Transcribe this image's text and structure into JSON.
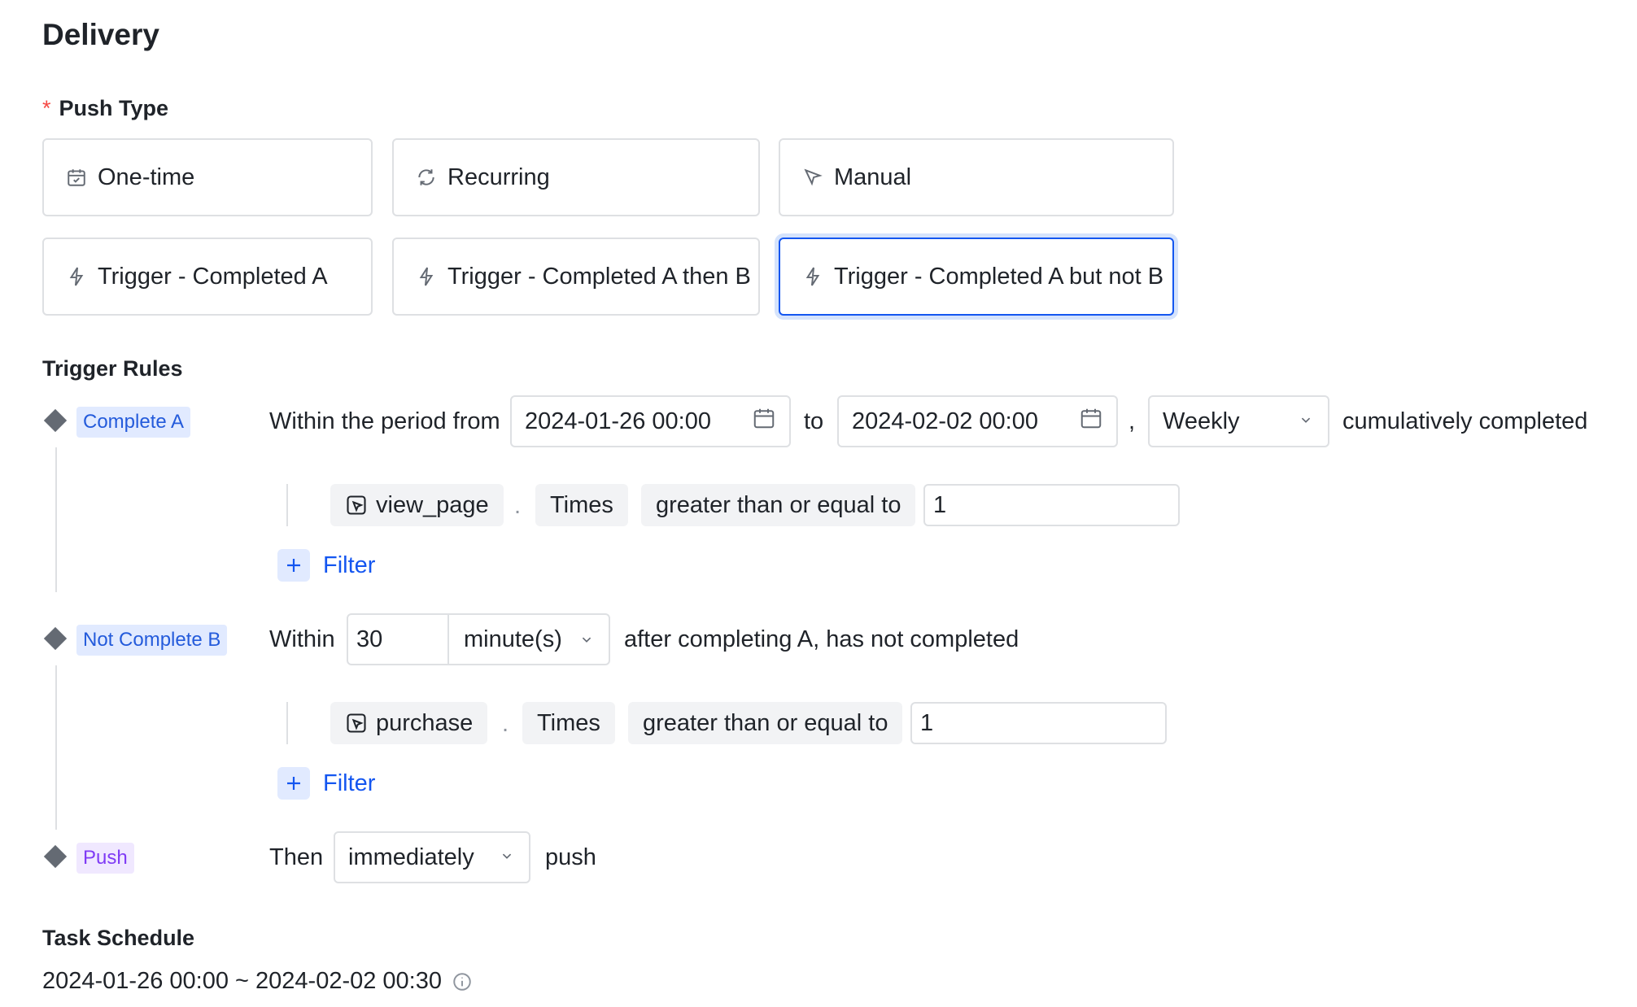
{
  "title": "Delivery",
  "push_type": {
    "required_mark": "*",
    "label": "Push Type",
    "options": [
      {
        "label": "One-time",
        "icon": "calendar-icon"
      },
      {
        "label": "Recurring",
        "icon": "refresh-icon"
      },
      {
        "label": "Manual",
        "icon": "cursor-icon"
      },
      {
        "label": "Trigger - Completed A",
        "icon": "lightning-icon"
      },
      {
        "label": "Trigger - Completed A then B",
        "icon": "lightning-icon"
      },
      {
        "label": "Trigger - Completed A but not B",
        "icon": "lightning-icon",
        "selected": true
      }
    ]
  },
  "trigger_rules": {
    "label": "Trigger Rules",
    "complete_a": {
      "tag": "Complete A",
      "within_text": "Within the period from",
      "start": "2024-01-26 00:00",
      "to_text": "to",
      "end": "2024-02-02 00:00",
      "comma": ",",
      "frequency": "Weekly",
      "suffix": "cumulatively completed",
      "event": "view_page",
      "dot": ".",
      "metric": "Times",
      "operator": "greater than or equal to",
      "value": "1",
      "filter_label": "Filter"
    },
    "not_complete_b": {
      "tag": "Not Complete B",
      "within_text": "Within",
      "amount": "30",
      "unit": "minute(s)",
      "suffix": "after completing A, has not completed",
      "event": "purchase",
      "dot": ".",
      "metric": "Times",
      "operator": "greater than or equal to",
      "value": "1",
      "filter_label": "Filter"
    },
    "push": {
      "tag": "Push",
      "then_text": "Then",
      "timing": "immediately",
      "suffix": "push"
    }
  },
  "task_schedule": {
    "label": "Task Schedule",
    "value": "2024-01-26 00:00 ~ 2024-02-02 00:30",
    "icon": "info-icon"
  },
  "colors": {
    "accent": "#1456f0",
    "tag_blue_bg": "#e1eaff",
    "tag_purple_bg": "#f0e8ff",
    "required": "#f54a45"
  }
}
